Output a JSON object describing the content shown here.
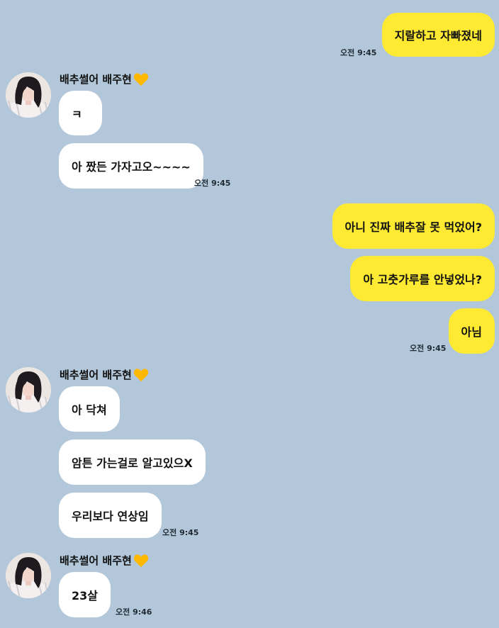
{
  "sender_name": "배추썰어 배주현",
  "colors": {
    "background": "#b2c7da",
    "mine": "#fee933",
    "theirs": "#ffffff",
    "heart": "#ffb800"
  },
  "messages": {
    "m1": {
      "text": "지랄하고 자빠졌네",
      "time": "오전 9:45"
    },
    "o1": {
      "text": "ㅋ"
    },
    "o2": {
      "text": "아 짰든 가자고오~~~~",
      "time": "오전 9:45"
    },
    "m2": {
      "text": "아니 진짜 배추잘 못 먹었어?"
    },
    "m3": {
      "text": "아 고춧가루를 안넣었나?"
    },
    "m4": {
      "text": "아님",
      "time": "오전 9:45"
    },
    "o3": {
      "text": "아 닥쳐"
    },
    "o4": {
      "text": "암튼 가는걸로 알고있으X"
    },
    "o5": {
      "text": "우리보다 연상임",
      "time": "오전 9:45"
    },
    "o6": {
      "text": "23살",
      "time": "오전 9:46"
    }
  }
}
